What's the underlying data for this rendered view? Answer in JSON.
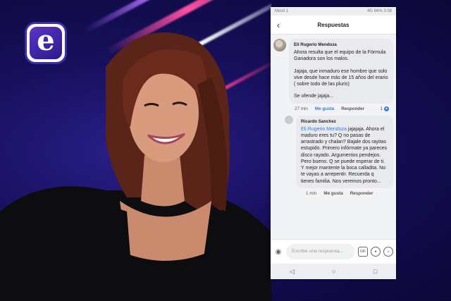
{
  "colors": {
    "background": "#160f5a",
    "accent_link": "#3578e5",
    "logo_purple": "#5c34c8"
  },
  "logo": {
    "letter": "e"
  },
  "phone": {
    "status_left": "Movil 1",
    "status_right": "4G 66%  3:08",
    "header": {
      "title": "Respuestas",
      "back_icon": "arrow-left-icon"
    },
    "comments": [
      {
        "author": "Eli Rugerio Mendoza",
        "paragraphs": [
          "Ahora resulta que el equipo de la Fórmula Ganadora son los malos.",
          "Jajaja, que inmaduro ese hombre que solo vive desde hace más de 15 años del erario ( sobre todo de las pluris)",
          "Se ofende jajaja..."
        ],
        "time": "27 min",
        "like": "Me gusta",
        "reply": "Responder",
        "reaction_count": "1"
      },
      {
        "author": "Ricardo Sanchez",
        "mention": "Eli Rugerio Mendoza",
        "text": " jajajaja. Ahora el maduro  eres tu? Q no pasas de arrastrado y chalan? Bajale dos rayitas estupido. Primero infórmate ya pareces disco rayado. Argumentos pendejos. Pero bueno. Q se puede esperar de ti. Y mejor mantente la boca calladita. No te vayas a arrepentir. Recuerda q tienes familia. Nos veremos pronto...",
        "time": "1 min",
        "like": "Me gusta",
        "reply": "Responder"
      }
    ],
    "composer": {
      "placeholder": "Escribe una respuesta...",
      "gif_label": "GIF"
    },
    "nav": {
      "back": "◁",
      "home": "○",
      "recent": "□"
    }
  }
}
